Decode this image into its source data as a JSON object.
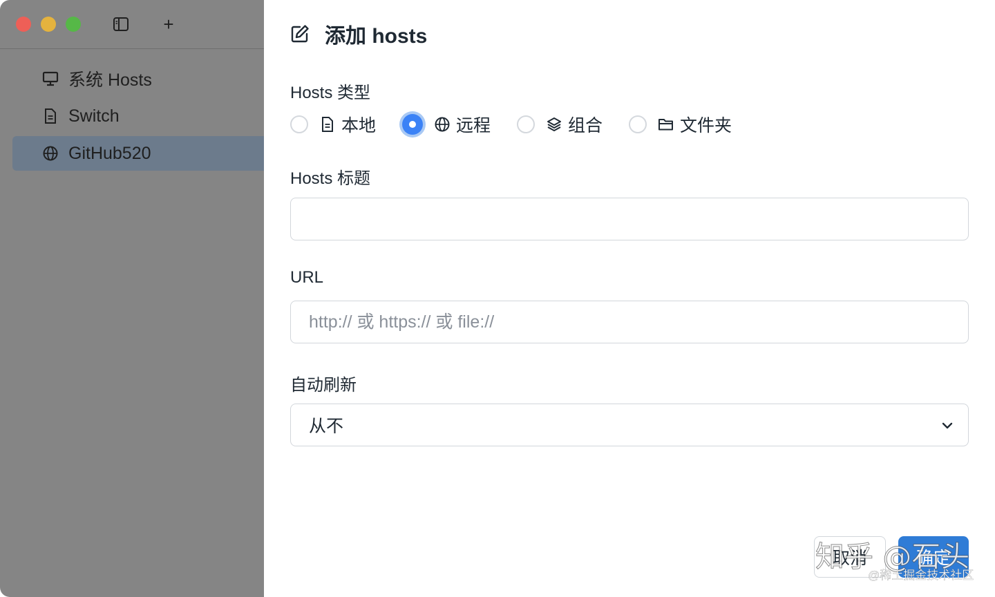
{
  "sidebar": {
    "items": [
      {
        "label": "系统 Hosts",
        "icon": "monitor-icon",
        "active": false
      },
      {
        "label": "Switch",
        "icon": "document-icon",
        "active": false
      },
      {
        "label": "GitHub520",
        "icon": "globe-icon",
        "active": true
      }
    ],
    "add_label": "+"
  },
  "dialog": {
    "title": "添加 hosts",
    "type_label": "Hosts 类型",
    "type_options": [
      {
        "label": "本地",
        "icon": "document-icon",
        "checked": false
      },
      {
        "label": "远程",
        "icon": "globe-icon",
        "checked": true
      },
      {
        "label": "组合",
        "icon": "layers-icon",
        "checked": false
      },
      {
        "label": "文件夹",
        "icon": "folder-icon",
        "checked": false
      }
    ],
    "title_label": "Hosts 标题",
    "title_value": "",
    "url_label": "URL",
    "url_placeholder": "http:// 或 https:// 或 file://",
    "refresh_label": "自动刷新",
    "refresh_value": "从不",
    "cancel_label": "取消",
    "ok_label": "确定"
  },
  "watermark": {
    "main": "知乎 @石头",
    "sub": "@稀土掘金技术社区"
  },
  "colors": {
    "accent": "#2f7cd6",
    "sidebar_overlay": "#858585",
    "sidebar_active": "#6c7b8c"
  }
}
